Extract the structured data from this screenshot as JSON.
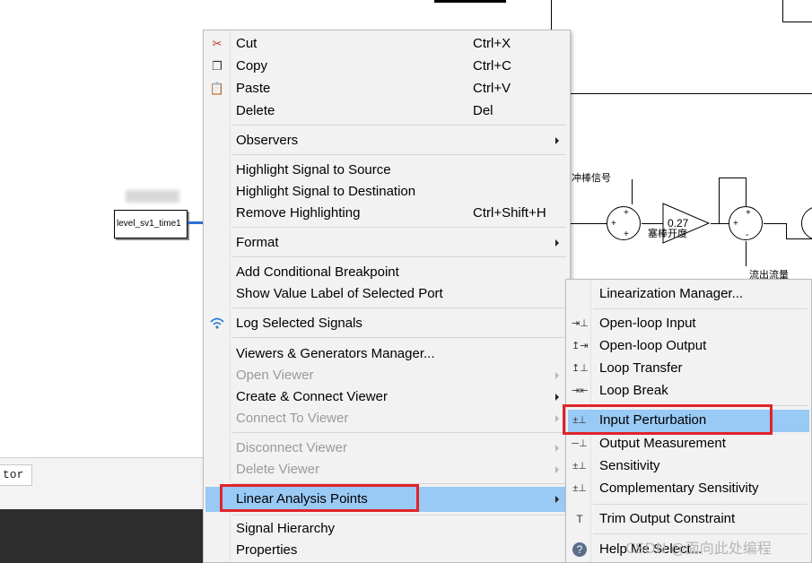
{
  "canvas": {
    "cjk_labels": [
      "冲棒信号",
      "塞棒开度",
      "流出流量"
    ],
    "gain_value": "0.27",
    "signal_block_label": "level_sv1_time1",
    "sum_signs": [
      "+",
      "+",
      "+",
      "+",
      "+",
      "-"
    ],
    "bottom_field_text": "tor"
  },
  "context_menu": {
    "items": [
      {
        "label": "Cut",
        "shortcut": "Ctrl+X",
        "icon": "scissors-icon"
      },
      {
        "label": "Copy",
        "shortcut": "Ctrl+C",
        "icon": "copy-icon"
      },
      {
        "label": "Paste",
        "shortcut": "Ctrl+V",
        "icon": "paste-icon"
      },
      {
        "label": "Delete",
        "shortcut": "Del"
      },
      {
        "label": "Observers",
        "submenu": true
      },
      {
        "label": "Highlight Signal to Source"
      },
      {
        "label": "Highlight Signal to Destination"
      },
      {
        "label": "Remove Highlighting",
        "shortcut": "Ctrl+Shift+H"
      },
      {
        "label": "Format",
        "submenu": true
      },
      {
        "label": "Add Conditional Breakpoint"
      },
      {
        "label": "Show Value Label of Selected Port"
      },
      {
        "label": "Log Selected Signals",
        "icon": "wifi-icon"
      },
      {
        "label": "Viewers & Generators Manager..."
      },
      {
        "label": "Open Viewer",
        "submenu": true,
        "disabled": true
      },
      {
        "label": "Create & Connect Viewer",
        "submenu": true
      },
      {
        "label": "Connect To Viewer",
        "submenu": true,
        "disabled": true
      },
      {
        "label": "Disconnect Viewer",
        "submenu": true,
        "disabled": true
      },
      {
        "label": "Delete Viewer",
        "submenu": true,
        "disabled": true
      },
      {
        "label": "Linear Analysis Points",
        "submenu": true,
        "highlighted": true
      },
      {
        "label": "Signal Hierarchy"
      },
      {
        "label": "Properties"
      }
    ]
  },
  "submenu": {
    "items": [
      {
        "label": "Linearization Manager..."
      },
      {
        "label": "Open-loop Input",
        "icon": "open-loop-input-icon"
      },
      {
        "label": "Open-loop Output",
        "icon": "open-loop-output-icon"
      },
      {
        "label": "Loop Transfer",
        "icon": "loop-transfer-icon"
      },
      {
        "label": "Loop Break",
        "icon": "loop-break-icon"
      },
      {
        "label": "Input Perturbation",
        "icon": "input-perturbation-icon",
        "highlighted": true
      },
      {
        "label": "Output Measurement",
        "icon": "output-measurement-icon"
      },
      {
        "label": "Sensitivity",
        "icon": "sensitivity-icon"
      },
      {
        "label": "Complementary Sensitivity",
        "icon": "complementary-sensitivity-icon"
      },
      {
        "label": "Trim Output Constraint",
        "icon": "trim-output-icon"
      },
      {
        "label": "Help Me Select...",
        "icon": "help-icon"
      }
    ]
  },
  "watermark": "CSDN @面向此处编程",
  "colors": {
    "highlight": "#99c9f5",
    "annotation_red": "#e0242b"
  }
}
